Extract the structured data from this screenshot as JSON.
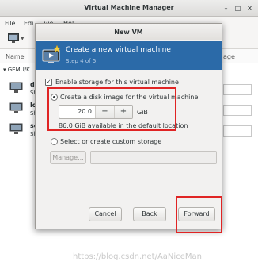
{
  "main_window": {
    "title": "Virtual Machine Manager",
    "menu": [
      "File",
      "Edi",
      "Vie",
      "Hel"
    ],
    "toolbar_icon": "new-vm-monitor-icon",
    "columns": {
      "name": "Name",
      "usage": "age"
    },
    "group": "GEMU/K",
    "vms": [
      {
        "name": "de",
        "state": "Sh"
      },
      {
        "name": "lo",
        "state": "Sh"
      },
      {
        "name": "se",
        "state": "Sh"
      }
    ],
    "window_controls": [
      "minimize",
      "maximize",
      "close"
    ]
  },
  "dialog": {
    "title": "New VM",
    "header": {
      "title": "Create a new virtual machine",
      "step": "Step 4 of 5",
      "icon": "monitor-star-icon",
      "color": "#2b6aa8"
    },
    "enable_storage": {
      "label": "Enable storage for this virtual machine",
      "checked": true
    },
    "create_disk": {
      "label": "Create a disk image for the virtual machine",
      "selected": true
    },
    "size": {
      "value": "20.0",
      "unit": "GiB",
      "minus": "−",
      "plus": "+"
    },
    "available": "86.0 GiB available in the default location",
    "custom_storage": {
      "label": "Select or create custom storage",
      "selected": false
    },
    "manage_label": "Manage...",
    "custom_path": "",
    "buttons": {
      "cancel": "Cancel",
      "back": "Back",
      "forward": "Forward"
    }
  },
  "annotation_color": "#e02424",
  "watermark": "https://blog.csdn.net/AaNiceMan"
}
